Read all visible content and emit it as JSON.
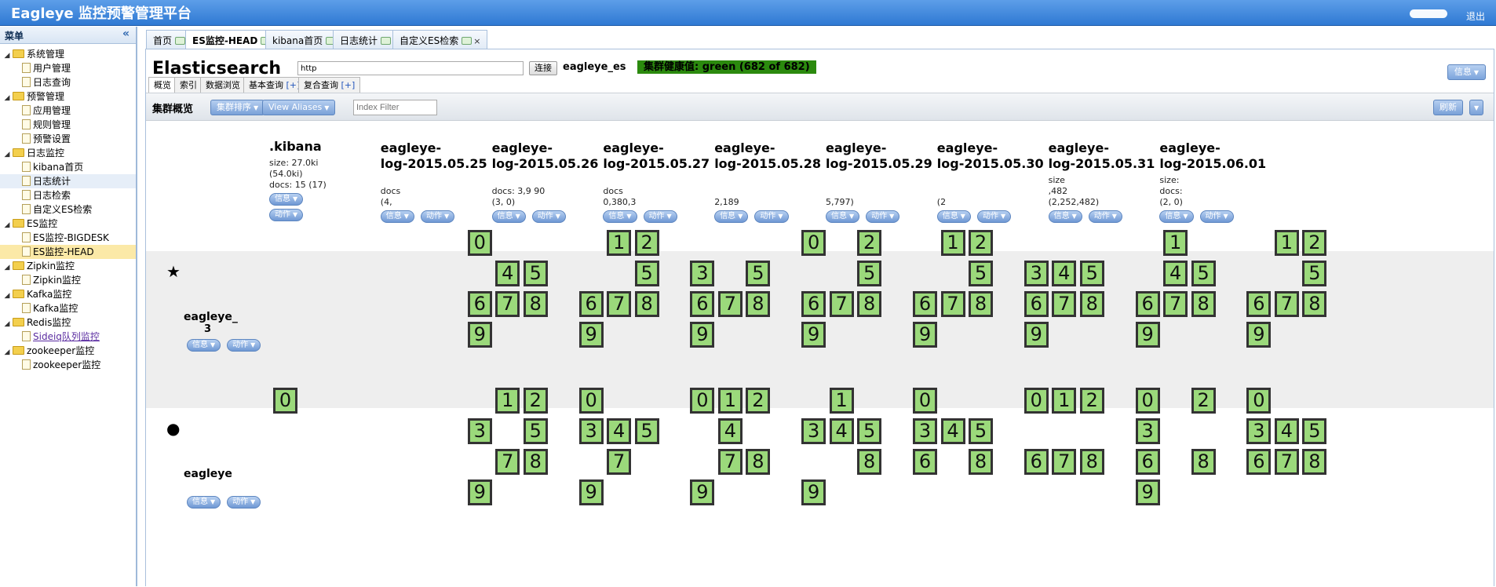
{
  "app": {
    "title": "Eagleye 监控预警管理平台",
    "logout": "退出"
  },
  "sidebar": {
    "title": "菜单",
    "tree": [
      {
        "label": "系统管理",
        "type": "folder",
        "level": 0
      },
      {
        "label": "用户管理",
        "type": "doc",
        "level": 1
      },
      {
        "label": "日志查询",
        "type": "doc",
        "level": 1
      },
      {
        "label": "预警管理",
        "type": "folder",
        "level": 0
      },
      {
        "label": "应用管理",
        "type": "doc",
        "level": 1
      },
      {
        "label": "规则管理",
        "type": "doc",
        "level": 1
      },
      {
        "label": "预警设置",
        "type": "doc",
        "level": 1
      },
      {
        "label": "日志监控",
        "type": "folder",
        "level": 0
      },
      {
        "label": "kibana首页",
        "type": "doc",
        "level": 1
      },
      {
        "label": "日志统计",
        "type": "doc",
        "level": 1
      },
      {
        "label": "日志检索",
        "type": "doc",
        "level": 1
      },
      {
        "label": "自定义ES检索",
        "type": "doc",
        "level": 1
      },
      {
        "label": "ES监控",
        "type": "folder",
        "level": 0
      },
      {
        "label": "ES监控-BIGDESK",
        "type": "doc",
        "level": 1
      },
      {
        "label": "ES监控-HEAD",
        "type": "doc",
        "level": 1
      },
      {
        "label": "Zipkin监控",
        "type": "folder",
        "level": 0
      },
      {
        "label": "Zipkin监控",
        "type": "doc",
        "level": 1
      },
      {
        "label": "Kafka监控",
        "type": "folder",
        "level": 0
      },
      {
        "label": "Kafka监控",
        "type": "doc",
        "level": 1
      },
      {
        "label": "Redis监控",
        "type": "folder",
        "level": 0
      },
      {
        "label": "Sideiq队列监控",
        "type": "doc",
        "level": 1
      },
      {
        "label": "zookeeper监控",
        "type": "folder",
        "level": 0
      },
      {
        "label": "zookeeper监控",
        "type": "doc",
        "level": 1
      }
    ]
  },
  "tabs": [
    {
      "label": "首页"
    },
    {
      "label": "ES监控-HEAD"
    },
    {
      "label": "kibana首页"
    },
    {
      "label": "日志统计"
    },
    {
      "label": "自定义ES检索"
    }
  ],
  "es": {
    "title": "Elasticsearch",
    "url": "http",
    "connect": "连接",
    "cluster": "eagleye_es",
    "health": "集群健康值: green (682 of 682)",
    "info": "信息",
    "subtabs": [
      "概览",
      "索引",
      "数据浏览",
      "基本查询",
      "复合查询"
    ],
    "plus": "[+]",
    "toolbar_title": "集群概览",
    "sort_btn": "集群排序",
    "aliases_btn": "View Aliases",
    "filter_placeholder": "Index Filter",
    "refresh": "刷新"
  },
  "buttons": {
    "info": "信息",
    "action": "动作"
  },
  "indices": [
    {
      "name1": ".kibana",
      "name2": "",
      "size": "size: 27.0ki",
      "size2": "(54.0ki)",
      "docs": "docs: 15 (17)"
    },
    {
      "name1": "eagleye-",
      "name2": "log-2015.05.25",
      "size": "",
      "size2": "docs",
      "docs": "(4,"
    },
    {
      "name1": "eagleye-",
      "name2": "log-2015.05.26",
      "size": "",
      "size2": "docs: 3,9      90",
      "docs": "(3,         0)"
    },
    {
      "name1": "eagleye-",
      "name2": "log-2015.05.27",
      "size": "",
      "size2": "docs",
      "docs": "0,380,3"
    },
    {
      "name1": "eagleye-",
      "name2": "log-2015.05.28",
      "size": "",
      "size2": "",
      "docs": "2,189"
    },
    {
      "name1": "eagleye-",
      "name2": "log-2015.05.29",
      "size": "",
      "size2": "",
      "docs": "5,797)"
    },
    {
      "name1": "eagleye-",
      "name2": "log-2015.05.30",
      "size": "",
      "size2": "",
      "docs": "(2"
    },
    {
      "name1": "eagleye-",
      "name2": "log-2015.05.31",
      "size": "size",
      "size2": ",482",
      "docs": "(2,252,482)"
    },
    {
      "name1": "eagleye-",
      "name2": "log-2015.06.01",
      "size": "size:",
      "size2": "docs:",
      "docs": "(2,          0)"
    }
  ],
  "nodes": [
    {
      "icon": "★",
      "name": "eagleye_",
      "sub": "3"
    },
    {
      "icon": "●",
      "name": "eagleye",
      "sub": ""
    }
  ]
}
